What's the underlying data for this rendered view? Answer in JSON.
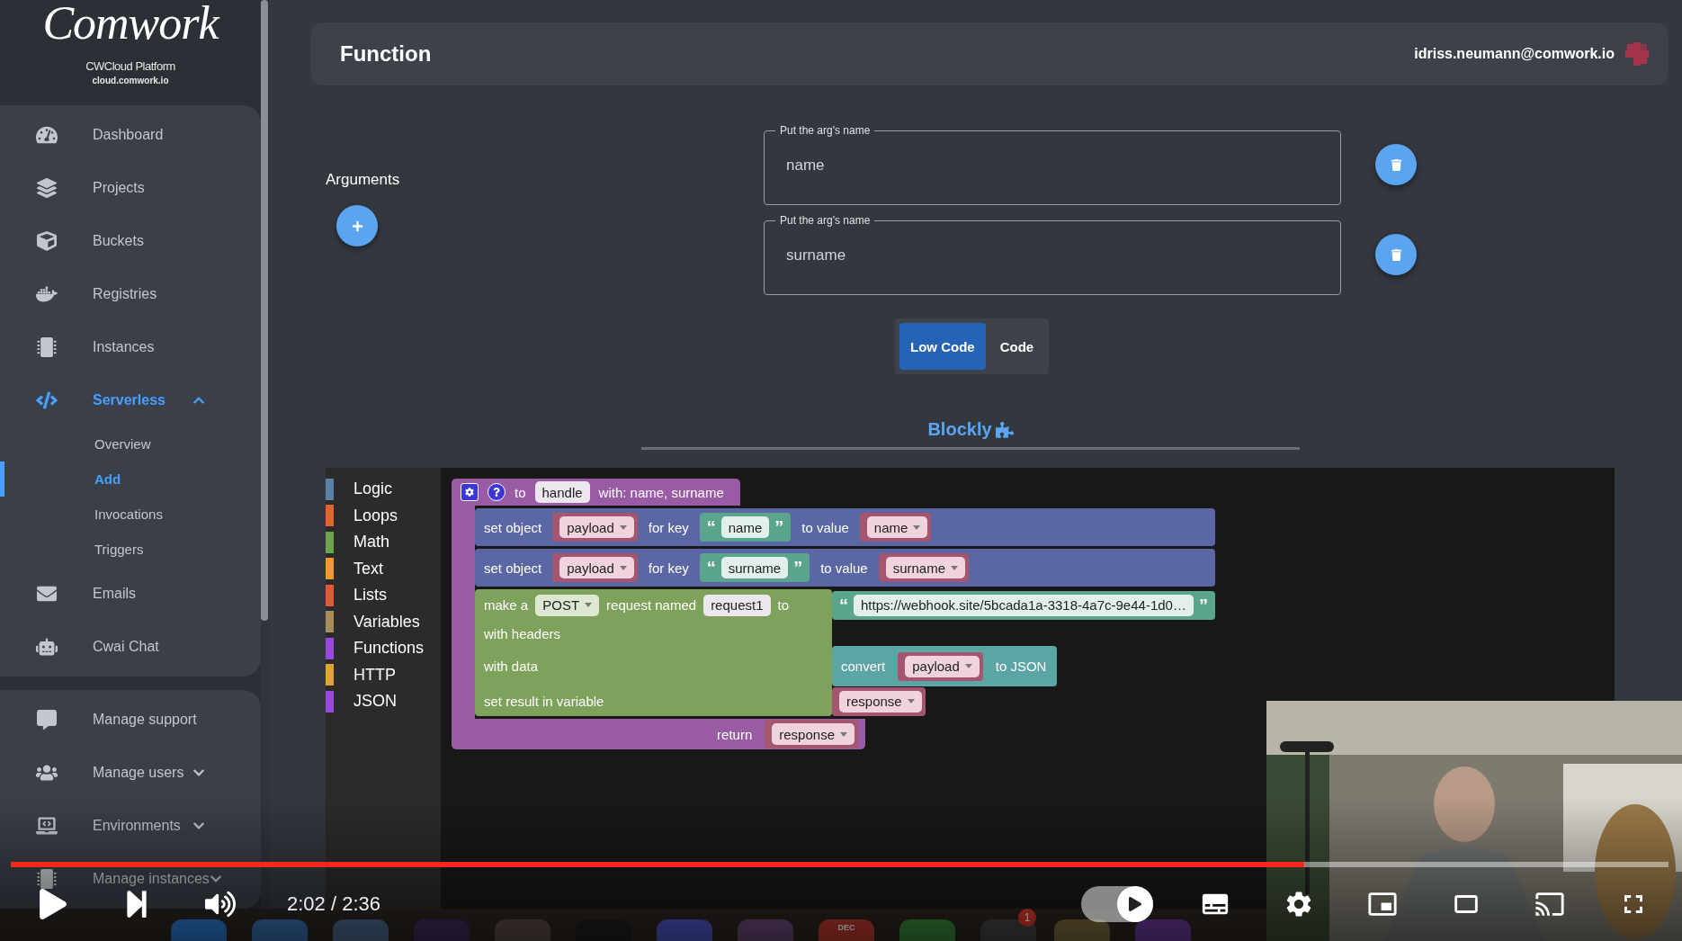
{
  "sidebar": {
    "logo": "Comwork",
    "platform": "CWCloud Platform",
    "domain": "cloud.comwork.io",
    "groups": [
      {
        "items": [
          {
            "label": "Dashboard",
            "selected": false
          },
          {
            "label": "Projects",
            "selected": false
          },
          {
            "label": "Buckets",
            "selected": false
          },
          {
            "label": "Registries",
            "selected": false
          },
          {
            "label": "Instances",
            "selected": false
          },
          {
            "label": "Serverless",
            "selected": true,
            "expanded": true,
            "children": [
              {
                "label": "Overview",
                "selected": false
              },
              {
                "label": "Add",
                "selected": true
              },
              {
                "label": "Invocations",
                "selected": false
              },
              {
                "label": "Triggers",
                "selected": false
              }
            ]
          },
          {
            "label": "Emails",
            "selected": false
          },
          {
            "label": "Cwai Chat",
            "selected": false
          }
        ]
      },
      {
        "items": [
          {
            "label": "Manage support",
            "selected": false
          },
          {
            "label": "Manage users",
            "selected": false,
            "expanded": false
          },
          {
            "label": "Environments",
            "selected": false,
            "expanded": false
          },
          {
            "label": "Manage instances",
            "selected": false,
            "expanded": false
          }
        ]
      }
    ]
  },
  "header": {
    "title": "Function",
    "user": "idriss.neumann@comwork.io"
  },
  "arguments": {
    "label": "Arguments",
    "fields": [
      {
        "label": "Put the arg's name",
        "value": "name"
      },
      {
        "label": "Put the arg's name",
        "value": "surname"
      }
    ]
  },
  "mode_toggle": [
    {
      "label": "Low Code",
      "selected": true
    },
    {
      "label": "Code",
      "selected": false
    }
  ],
  "blockly": {
    "title": "Blockly",
    "toolbox": [
      {
        "label": "Logic",
        "color": "#5b80a5"
      },
      {
        "label": "Loops",
        "color": "#e8622c"
      },
      {
        "label": "Math",
        "color": "#6ea24e"
      },
      {
        "label": "Text",
        "color": "#f09a2b"
      },
      {
        "label": "Lists",
        "color": "#e2593a"
      },
      {
        "label": "Variables",
        "color": "#a58e5b"
      },
      {
        "label": "Functions",
        "color": "#9a49e0"
      },
      {
        "label": "HTTP",
        "color": "#e0a52b"
      },
      {
        "label": "JSON",
        "color": "#9a49e0"
      }
    ],
    "function_block": {
      "header": [
        {
          "kind": "text",
          "text": "to"
        },
        {
          "kind": "field",
          "text": "handle"
        },
        {
          "kind": "text",
          "text": "with: name, surname"
        }
      ],
      "statements": [
        {
          "kind": "set",
          "tokens": [
            {
              "kind": "text",
              "text": "set object"
            },
            {
              "kind": "variable",
              "text": "payload"
            },
            {
              "kind": "text",
              "text": "for key"
            },
            {
              "kind": "string",
              "open": "“",
              "text": "name",
              "close": "”"
            },
            {
              "kind": "text",
              "text": "to value"
            },
            {
              "kind": "variable",
              "text": "name"
            }
          ]
        },
        {
          "kind": "set",
          "tokens": [
            {
              "kind": "text",
              "text": "set object"
            },
            {
              "kind": "variable",
              "text": "payload"
            },
            {
              "kind": "text",
              "text": "for key"
            },
            {
              "kind": "string",
              "open": "“",
              "text": "surname",
              "close": "”"
            },
            {
              "kind": "text",
              "text": "to value"
            },
            {
              "kind": "variable",
              "text": "surname"
            }
          ]
        },
        {
          "kind": "http",
          "lines": [
            {
              "tokens": [
                {
                  "kind": "text",
                  "text": "make a"
                },
                {
                  "kind": "dropdown",
                  "text": "POST"
                },
                {
                  "kind": "text",
                  "text": "request named"
                },
                {
                  "kind": "field",
                  "text": "request1"
                },
                {
                  "kind": "text",
                  "text": "to"
                }
              ],
              "input": {
                "kind": "string",
                "open": "“",
                "text": "https://webhook.site/5bcada1a-3318-4a7c-9e44-1d0…",
                "close": "”"
              }
            },
            {
              "tokens": [
                {
                  "kind": "text",
                  "text": "with headers"
                }
              ]
            },
            {
              "tokens": [
                {
                  "kind": "text",
                  "text": "with data"
                }
              ],
              "input": {
                "kind": "block",
                "tokens": [
                  {
                    "kind": "text",
                    "text": "convert"
                  },
                  {
                    "kind": "variable",
                    "text": "payload"
                  },
                  {
                    "kind": "text",
                    "text": "to JSON"
                  }
                ]
              }
            },
            {
              "tokens": [
                {
                  "kind": "text",
                  "text": "set result in variable"
                }
              ],
              "input": {
                "kind": "variable",
                "text": "response"
              }
            }
          ]
        }
      ],
      "footer": [
        {
          "kind": "text",
          "text": "return"
        },
        {
          "kind": "variable",
          "text": "response"
        }
      ]
    }
  },
  "dock": {
    "calendar_label": "DEC",
    "badge": "1"
  },
  "player": {
    "progress": {
      "level": 0.78
    },
    "time": "2:02 / 2:36",
    "autoplay": {
      "on": true
    }
  }
}
